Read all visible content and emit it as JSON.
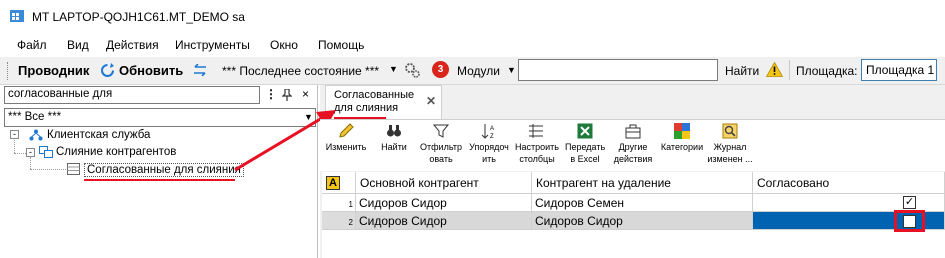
{
  "window": {
    "title": "MT LAPTOP-QOJH1C61.MT_DEMO sa"
  },
  "menu": [
    "Файл",
    "Вид",
    "Действия",
    "Инструменты",
    "Окно",
    "Помощь"
  ],
  "toolbar": {
    "explorer": "Проводник",
    "refresh": "Обновить",
    "state": "*** Последнее состояние ***",
    "badge": "3",
    "modules": "Модули",
    "find": "Найти",
    "area_label": "Площадка:",
    "area_value": "Площадка 1"
  },
  "left": {
    "search": "согласованные для",
    "filter": "*** Все ***",
    "tree": [
      {
        "label": "Клиентская служба"
      },
      {
        "label": "Слияние контрагентов"
      },
      {
        "label": "Согласованные для слияния"
      }
    ]
  },
  "tab": {
    "label": "Согласованные для слияния"
  },
  "ribbon": [
    {
      "label": "Изменить"
    },
    {
      "label": "Найти"
    },
    {
      "label": "Отфильтр овать"
    },
    {
      "label": "Упорядоч ить"
    },
    {
      "label": "Настроить столбцы"
    },
    {
      "label": "Передать в Excel"
    },
    {
      "label": "Другие действия"
    },
    {
      "label": "Категории"
    },
    {
      "label": "Журнал изменен ..."
    }
  ],
  "grid": {
    "corner": "A",
    "columns": [
      "Основной контрагент",
      "Контрагент на удаление",
      "Согласовано"
    ],
    "rows": [
      {
        "num": "1",
        "main": "Сидоров Сидор",
        "delete": "Сидоров Семен",
        "approved": true
      },
      {
        "num": "2",
        "main": "Сидоров Сидор",
        "delete": "Сидоров Сидор",
        "approved": false
      }
    ]
  },
  "colors": {
    "accent": "#0063b1",
    "highlight": "#e81123",
    "badge": "#d9241c"
  }
}
